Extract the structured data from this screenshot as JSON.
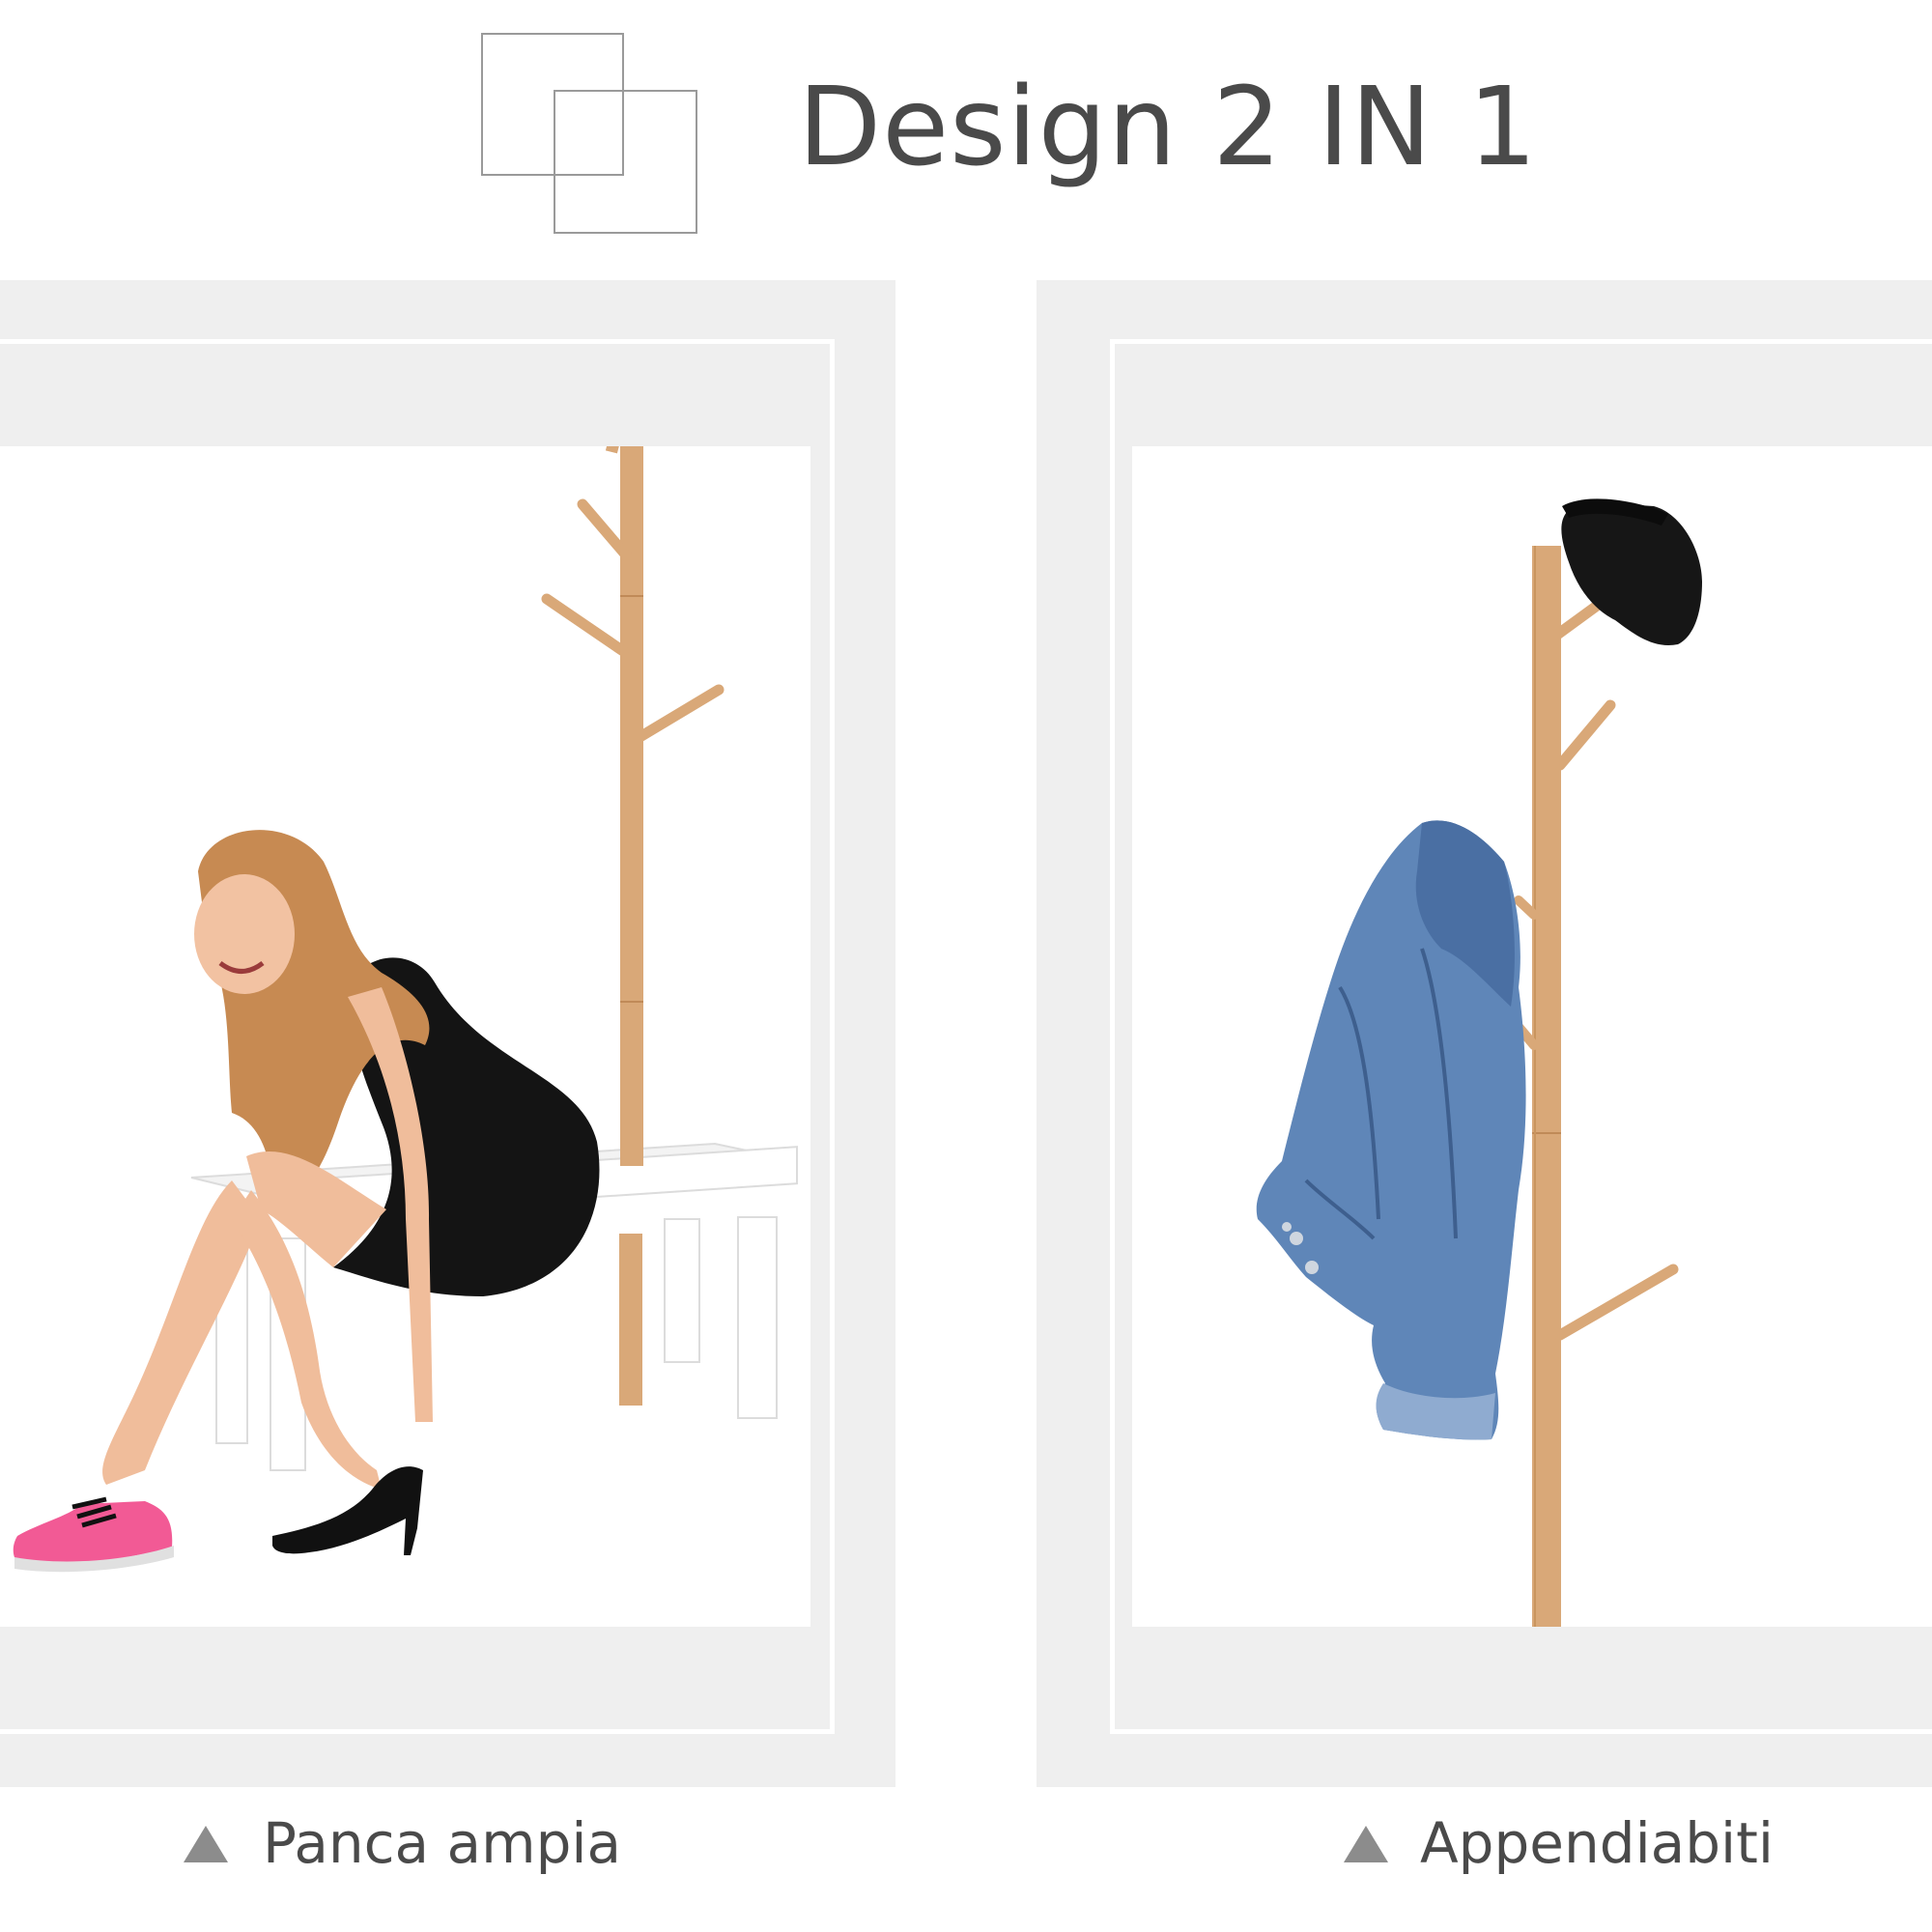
{
  "header": {
    "title": "Design 2 IN 1",
    "logo_icon": "overlapping-squares-icon"
  },
  "panels": [
    {
      "caption": "Panca ampia",
      "bullet_icon": "triangle-up-icon",
      "image": "woman-sitting-on-white-bench-with-bamboo-coat-tree"
    },
    {
      "caption": "Appendiabiti",
      "bullet_icon": "triangle-up-icon",
      "image": "bamboo-coat-tree-with-hat-and-denim-jacket"
    }
  ],
  "colors": {
    "frame": "#efefef",
    "text": "#4a4a4a",
    "bamboo": "#d6a77a",
    "triangle": "#8c8c8c"
  }
}
